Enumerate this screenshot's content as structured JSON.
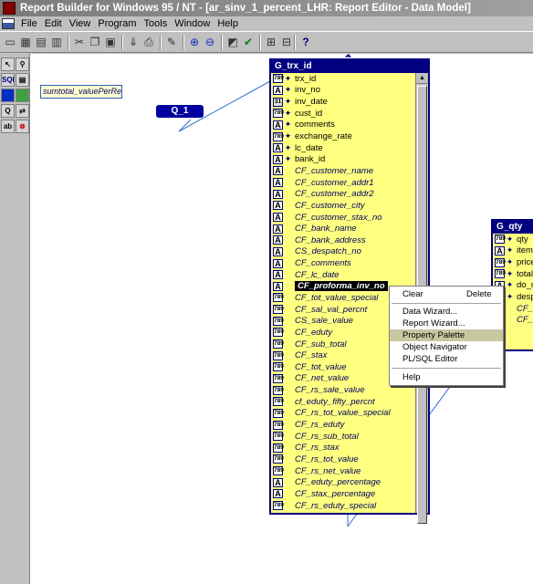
{
  "window": {
    "title": "Report Builder for Windows 95 / NT - [ar_sinv_1_percent_LHR: Report Editor - Data Model]"
  },
  "menu": [
    "File",
    "Edit",
    "View",
    "Program",
    "Tools",
    "Window",
    "Help"
  ],
  "toolbar": [
    "new-icon",
    "open-icon",
    "save-icon",
    "print-icon",
    "cut-icon",
    "copy-icon",
    "paste-icon",
    "run-icon",
    "print-preview-icon",
    "compile-icon",
    "zoom-in-icon",
    "zoom-out-icon",
    "filter-icon",
    "check-icon",
    "collapse-icon",
    "expand-icon",
    "help-icon"
  ],
  "palette": [
    "select-tool",
    "magnify-tool",
    "sql-query-tool",
    "group-tool",
    "summary-tool",
    "formula-tool",
    "placeholder-tool",
    "data-link-tool",
    "ref-cursor-tool",
    "cross-product-tool"
  ],
  "field_box": {
    "text": "sumtotal_valuePerRepo"
  },
  "query": {
    "label": "Q_1"
  },
  "group_main": {
    "title": "G_trx_id",
    "rows": [
      {
        "icon": "789",
        "key": true,
        "name": "trx_id",
        "cf": false
      },
      {
        "icon": "A",
        "key": true,
        "name": "inv_no",
        "cf": false
      },
      {
        "icon": "31",
        "key": true,
        "name": "inv_date",
        "cf": false
      },
      {
        "icon": "789",
        "key": true,
        "name": "cust_id",
        "cf": false
      },
      {
        "icon": "A",
        "key": true,
        "name": "comments",
        "cf": false
      },
      {
        "icon": "789",
        "key": true,
        "name": "exchange_rate",
        "cf": false
      },
      {
        "icon": "A",
        "key": true,
        "name": "lc_date",
        "cf": false
      },
      {
        "icon": "A",
        "key": true,
        "name": "bank_id",
        "cf": false
      },
      {
        "icon": "A",
        "key": false,
        "name": "CF_customer_name",
        "cf": true
      },
      {
        "icon": "A",
        "key": false,
        "name": "CF_customer_addr1",
        "cf": true
      },
      {
        "icon": "A",
        "key": false,
        "name": "CF_customer_addr2",
        "cf": true
      },
      {
        "icon": "A",
        "key": false,
        "name": "CF_customer_city",
        "cf": true
      },
      {
        "icon": "A",
        "key": false,
        "name": "CF_customer_stax_no",
        "cf": true
      },
      {
        "icon": "A",
        "key": false,
        "name": "CF_bank_name",
        "cf": true
      },
      {
        "icon": "A",
        "key": false,
        "name": "CF_bank_address",
        "cf": true
      },
      {
        "icon": "A",
        "key": false,
        "name": "CS_despatch_no",
        "cf": true
      },
      {
        "icon": "A",
        "key": false,
        "name": "CF_comments",
        "cf": true
      },
      {
        "icon": "A",
        "key": false,
        "name": "CF_lc_date",
        "cf": true
      },
      {
        "icon": "A",
        "key": false,
        "name": "CF_proforma_inv_no",
        "cf": true,
        "selected": true
      },
      {
        "icon": "789",
        "key": false,
        "name": "CF_tot_value_special",
        "cf": true
      },
      {
        "icon": "789",
        "key": false,
        "name": "CF_sal_val_percnt",
        "cf": true
      },
      {
        "icon": "789",
        "key": false,
        "name": "CS_sale_value",
        "cf": true
      },
      {
        "icon": "789",
        "key": false,
        "name": "CF_eduty",
        "cf": true
      },
      {
        "icon": "789",
        "key": false,
        "name": "CF_sub_total",
        "cf": true
      },
      {
        "icon": "789",
        "key": false,
        "name": "CF_stax",
        "cf": true
      },
      {
        "icon": "789",
        "key": false,
        "name": "CF_tot_value",
        "cf": true
      },
      {
        "icon": "789",
        "key": false,
        "name": "CF_net_value",
        "cf": true
      },
      {
        "icon": "789",
        "key": false,
        "name": "CF_rs_sale_value",
        "cf": true
      },
      {
        "icon": "789",
        "key": false,
        "name": "cf_eduty_fifty_percnt",
        "cf": true
      },
      {
        "icon": "789",
        "key": false,
        "name": "CF_rs_tot_value_special",
        "cf": true
      },
      {
        "icon": "789",
        "key": false,
        "name": "CF_rs_eduty",
        "cf": true
      },
      {
        "icon": "789",
        "key": false,
        "name": "CF_rs_sub_total",
        "cf": true
      },
      {
        "icon": "789",
        "key": false,
        "name": "CF_rs_stax",
        "cf": true
      },
      {
        "icon": "789",
        "key": false,
        "name": "CF_rs_tot_value",
        "cf": true
      },
      {
        "icon": "789",
        "key": false,
        "name": "CF_rs_net_value",
        "cf": true
      },
      {
        "icon": "A",
        "key": false,
        "name": "CF_eduty_percentage",
        "cf": true
      },
      {
        "icon": "A",
        "key": false,
        "name": "CF_stax_percentage",
        "cf": true
      },
      {
        "icon": "789",
        "key": false,
        "name": "CF_rs_eduty_special",
        "cf": true
      }
    ]
  },
  "group_qty": {
    "title": "G_qty",
    "rows": [
      {
        "icon": "789",
        "key": true,
        "name": "qty",
        "cf": false
      },
      {
        "icon": "A",
        "key": true,
        "name": "item_",
        "cf": false
      },
      {
        "icon": "789",
        "key": true,
        "name": "price",
        "cf": false
      },
      {
        "icon": "789",
        "key": true,
        "name": "total_",
        "cf": false
      },
      {
        "icon": "A",
        "key": true,
        "name": "do_n",
        "cf": false
      },
      {
        "icon": "A",
        "key": true,
        "name": "desp",
        "cf": false
      },
      {
        "icon": "789",
        "key": false,
        "name": "CF_",
        "cf": true
      },
      {
        "icon": "789",
        "key": false,
        "name": "CF_",
        "cf": true
      }
    ]
  },
  "context_menu": {
    "clear": "Clear",
    "delete": "Delete",
    "data_wizard": "Data Wizard...",
    "report_wizard": "Report Wizard...",
    "property_palette": "Property Palette",
    "object_navigator": "Object Navigator",
    "plsql_editor": "PL/SQL Editor",
    "help": "Help"
  }
}
